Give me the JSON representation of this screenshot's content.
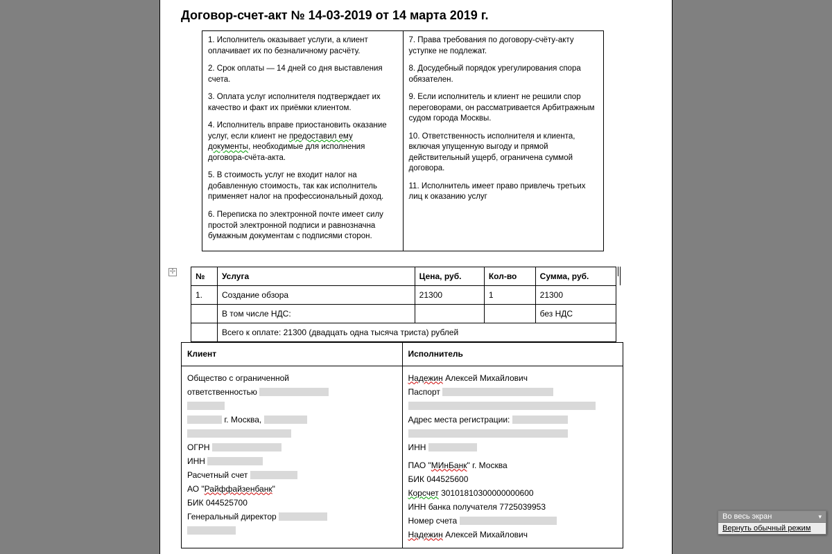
{
  "title": "Договор-счет-акт № 14-03-2019 от 14 марта 2019 г.",
  "terms_left": [
    "1. Исполнитель оказывает услуги, а клиент оплачивает их по безналичному расчёту.",
    "2. Срок оплаты — 14 дней со дня выставления счета.",
    "3. Оплата услуг исполнителя подтверждает их качество и факт их приёмки клиентом.",
    "4. Исполнитель вправе приостановить оказание услуг, если клиент не предоставил ему документы, необходимые для исполнения договора-счёта-акта.",
    "5. В стоимость услуг не входит налог на добавленную стоимость, так как исполнитель применяет налог на профессиональный доход.",
    "6. Переписка по электронной почте имеет силу простой электронной подписи и равнозначна бумажным документам с подписями сторон."
  ],
  "terms_right": [
    "7. Права требования по договору-счёту-акту уступке не подлежат.",
    "8. Досудебный порядок урегулирования спора обязателен.",
    "9. Если исполнитель и клиент не решили спор переговорами, он рассматривается Арбитражным судом города Москвы.",
    "10. Ответственность исполнителя и клиента, включая упущенную выгоду и прямой действительный ущерб, ограничена суммой договора.",
    "11. Исполнитель имеет право привлечь третьих лиц к оказанию услуг"
  ],
  "services": {
    "headers": {
      "num": "№",
      "service": "Услуга",
      "price": "Цена, руб.",
      "qty": "Кол-во",
      "sum": "Сумма,  руб."
    },
    "rows": [
      {
        "num": "1.",
        "service": "Создание обзора",
        "price": "21300",
        "qty": "1",
        "sum": "21300"
      }
    ],
    "vat_label": "В том числе НДС:",
    "vat_value": "без НДС",
    "total": "Всего к оплате: 21300 (двадцать одна тысяча триста) рублей"
  },
  "parties": {
    "client_header": "Клиент",
    "executor_header": "Исполнитель",
    "client": {
      "l1": "Общество с ограниченной",
      "l2_prefix": "ответственностью",
      "city": "г. Москва,",
      "ogrn_label": "ОГРН",
      "inn_label": "ИНН",
      "acct_label": "Расчетный счет",
      "bank": "АО \"Райффайзенбанк\"",
      "bik": "БИК 044525700",
      "director_label": "Генеральный директор"
    },
    "executor": {
      "name_prefix": "Надежин",
      "name_rest": " Алексей Михайлович",
      "passport_label": "Паспорт",
      "addr_label": "Адрес места регистрации:",
      "inn_label": "ИНН",
      "bank_prefix": "ПАО \"",
      "bank_spell": "МИнБанк",
      "bank_suffix": "\" г. Москва",
      "bik": "БИК 044525600",
      "korr": "Корсчет 30101810300000000600",
      "bank_inn": "ИНН банка получателя 7725039953",
      "acct_label": "Номер счета",
      "sign_prefix": "Надежин",
      "sign_rest": " Алексей Михайлович"
    }
  },
  "float": {
    "title": "Во весь экран",
    "link": "Вернуть обычный режим"
  }
}
